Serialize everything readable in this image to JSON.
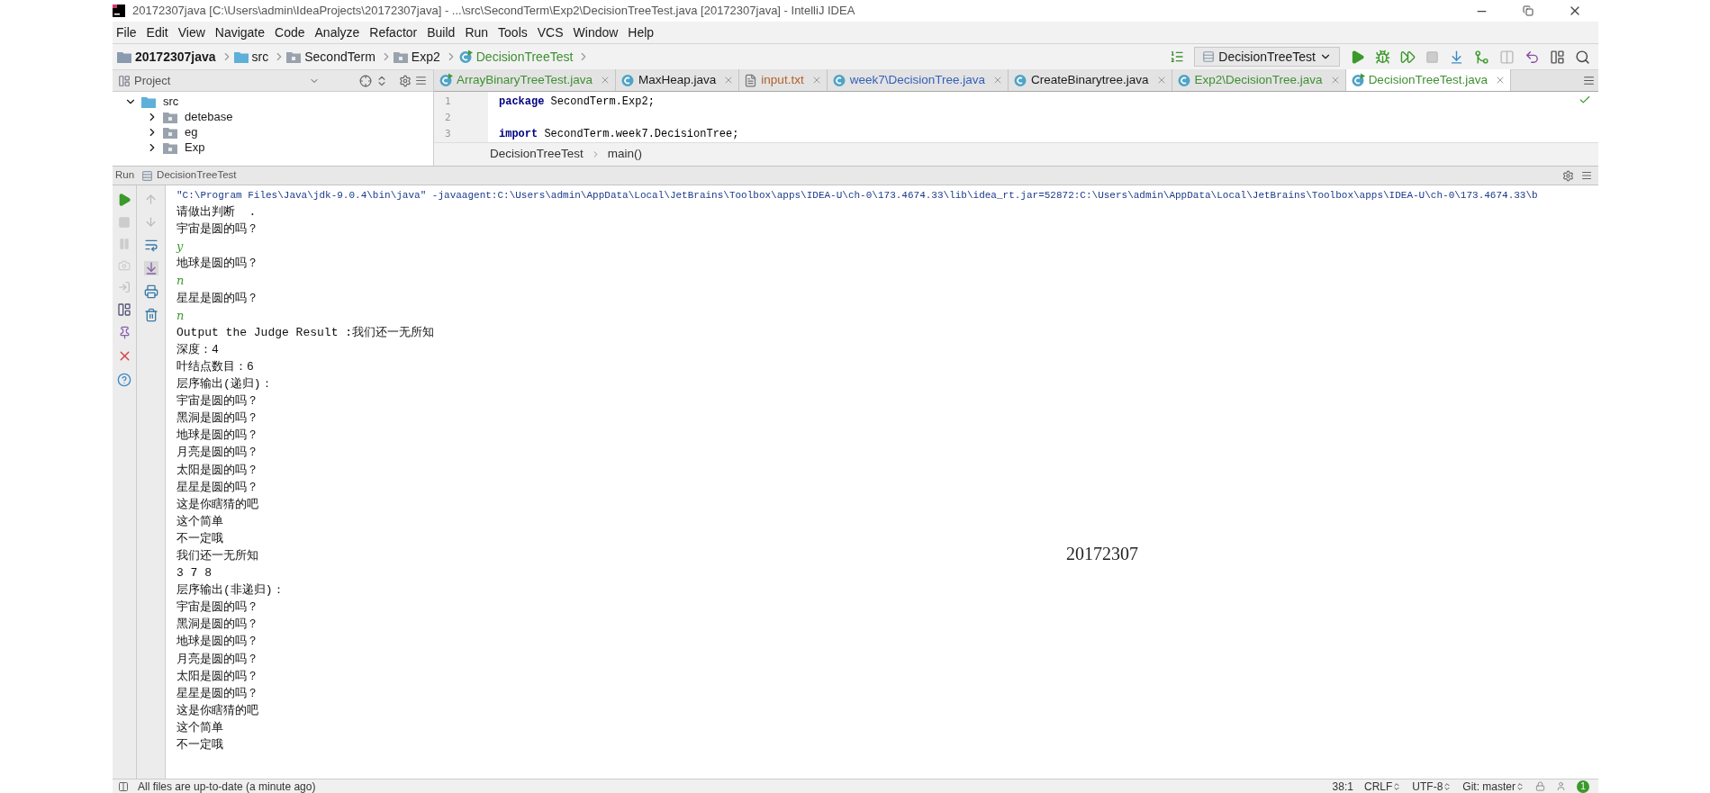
{
  "window": {
    "title": "20172307java [C:\\Users\\admin\\IdeaProjects\\20172307java] - ...\\src\\SecondTerm\\Exp2\\DecisionTreeTest.java [20172307java] - IntelliJ IDEA"
  },
  "menu": [
    "File",
    "Edit",
    "View",
    "Navigate",
    "Code",
    "Analyze",
    "Refactor",
    "Build",
    "Run",
    "Tools",
    "VCS",
    "Window",
    "Help"
  ],
  "navigation_bar": {
    "breadcrumbs": [
      {
        "label": "20172307java",
        "kind": "project"
      },
      {
        "label": "src",
        "kind": "source"
      },
      {
        "label": "SecondTerm",
        "kind": "package"
      },
      {
        "label": "Exp2",
        "kind": "package"
      },
      {
        "label": "DecisionTreeTest",
        "kind": "class"
      }
    ],
    "run_configuration": "DecisionTreeTest"
  },
  "project_panel": {
    "title": "Project",
    "tree": [
      {
        "label": "src",
        "kind": "source",
        "expanded": true,
        "children": [
          {
            "label": "detebase",
            "kind": "package",
            "expanded": false
          },
          {
            "label": "eg",
            "kind": "package",
            "expanded": false
          },
          {
            "label": "Exp",
            "kind": "package",
            "expanded": false
          }
        ]
      }
    ]
  },
  "editor_tabs": [
    {
      "label": "ArrayBinaryTreeTest.java",
      "kind": "runnable",
      "color": "#3f8f33",
      "selected": false
    },
    {
      "label": "MaxHeap.java",
      "kind": "class",
      "color": "#1a1a1a",
      "selected": false
    },
    {
      "label": "input.txt",
      "kind": "text",
      "color": "#b0602a",
      "selected": false
    },
    {
      "label": "week7\\DecisionTree.java",
      "kind": "class",
      "color": "#3560b8",
      "selected": false
    },
    {
      "label": "CreateBinarytree.java",
      "kind": "class",
      "color": "#1a1a1a",
      "selected": false
    },
    {
      "label": "Exp2\\DecisionTree.java",
      "kind": "class",
      "color": "#3f8f33",
      "selected": false
    },
    {
      "label": "DecisionTreeTest.java",
      "kind": "runnable",
      "color": "#3f8f33",
      "selected": true
    }
  ],
  "editor": {
    "lines": [
      {
        "number": "1",
        "code": "**package** SecondTerm.Exp2;"
      },
      {
        "number": "2"
      },
      {
        "number": "3",
        "code": "**import** SecondTerm.week7.DecisionTree;"
      }
    ],
    "breadcrumbs": [
      "DecisionTreeTest",
      "main()"
    ]
  },
  "run_panel": {
    "title": "Run",
    "configuration": "DecisionTreeTest",
    "console": [
      {
        "kind": "command",
        "text": "\"C:\\Program Files\\Java\\jdk-9.0.4\\bin\\java\" -javaagent:C:\\Users\\admin\\AppData\\Local\\JetBrains\\Toolbox\\apps\\IDEA-U\\ch-0\\173.4674.33\\lib\\idea_rt.jar=52872:C:\\Users\\admin\\AppData\\Local\\JetBrains\\Toolbox\\apps\\IDEA-U\\ch-0\\173.4674.33\\b"
      },
      {
        "kind": "output",
        "text": "请做出判断  ."
      },
      {
        "kind": "output",
        "text": "宇宙是圆的吗？"
      },
      {
        "kind": "input",
        "text": "y"
      },
      {
        "kind": "output",
        "text": "地球是圆的吗？"
      },
      {
        "kind": "input",
        "text": "n"
      },
      {
        "kind": "output",
        "text": "星星是圆的吗？"
      },
      {
        "kind": "input",
        "text": "n"
      },
      {
        "kind": "output",
        "text": "Output the Judge Result :我们还一无所知"
      },
      {
        "kind": "output",
        "text": "深度：4"
      },
      {
        "kind": "output",
        "text": "叶结点数目：6"
      },
      {
        "kind": "output",
        "text": "层序输出(递归)："
      },
      {
        "kind": "output",
        "text": "宇宙是圆的吗？"
      },
      {
        "kind": "output",
        "text": "黑洞是圆的吗？"
      },
      {
        "kind": "output",
        "text": "地球是圆的吗？"
      },
      {
        "kind": "output",
        "text": "月亮是圆的吗？"
      },
      {
        "kind": "output",
        "text": "太阳是圆的吗？"
      },
      {
        "kind": "output",
        "text": "星星是圆的吗？"
      },
      {
        "kind": "output",
        "text": "这是你瞎猜的吧"
      },
      {
        "kind": "output",
        "text": "这个简单"
      },
      {
        "kind": "output",
        "text": "不一定哦"
      },
      {
        "kind": "output",
        "text": "我们还一无所知"
      },
      {
        "kind": "output",
        "text": "3 7 8"
      },
      {
        "kind": "output",
        "text": "层序输出(非递归)："
      },
      {
        "kind": "output",
        "text": "宇宙是圆的吗？"
      },
      {
        "kind": "output",
        "text": "黑洞是圆的吗？"
      },
      {
        "kind": "output",
        "text": "地球是圆的吗？"
      },
      {
        "kind": "output",
        "text": "月亮是圆的吗？"
      },
      {
        "kind": "output",
        "text": "太阳是圆的吗？"
      },
      {
        "kind": "output",
        "text": "星星是圆的吗？"
      },
      {
        "kind": "output",
        "text": "这是你瞎猜的吧"
      },
      {
        "kind": "output",
        "text": "这个简单"
      },
      {
        "kind": "output",
        "text": "不一定哦"
      }
    ],
    "overlay_text": "20172307"
  },
  "status_bar": {
    "message": "All files are up-to-date (a minute ago)",
    "position": "38:1",
    "line_separator": "CRLF",
    "encoding": "UTF-8",
    "vcs": "Git: master",
    "notifications": "1"
  }
}
